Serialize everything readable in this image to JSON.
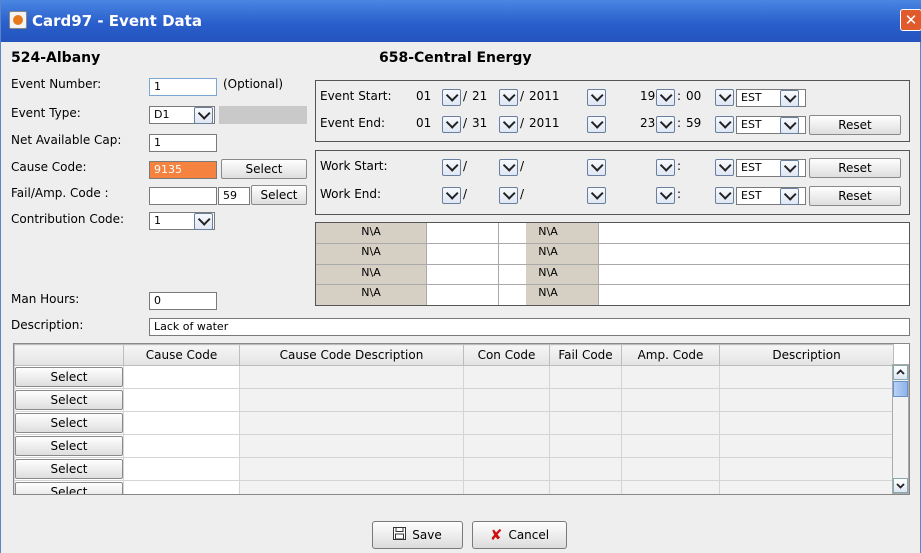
{
  "window": {
    "title": "Card97 - Event Data"
  },
  "unit": {
    "left_name": "524-Albany",
    "right_name": "658-Central Energy"
  },
  "fields": {
    "event_number_label": "Event Number:",
    "event_number": "1",
    "optional_note": "(Optional)",
    "event_type_label": "Event Type:",
    "event_type": "D1",
    "net_available_cap_label": "Net Available Cap:",
    "net_available_cap": "1",
    "cause_code_label": "Cause Code:",
    "cause_code": "9135",
    "cause_select": "Select",
    "fail_amp_label": "Fail/Amp. Code :",
    "fail_code": "",
    "amp_code": "59",
    "fail_select": "Select",
    "contribution_label": "Contribution Code:",
    "contribution": "1",
    "man_hours_label": "Man Hours:",
    "man_hours": "0",
    "description_label": "Description:",
    "description": "Lack of water"
  },
  "event_times": {
    "start_label": "Event Start:",
    "end_label": "Event End:",
    "start": {
      "month": "01",
      "day": "21",
      "year": "2011",
      "hour": "19",
      "minute": "00",
      "tz": "EST"
    },
    "end": {
      "month": "01",
      "day": "31",
      "year": "2011",
      "hour": "23",
      "minute": "59",
      "tz": "EST"
    },
    "reset": "Reset",
    "slash": "/",
    "colon": ":"
  },
  "work_times": {
    "start_label": "Work Start:",
    "end_label": "Work End:",
    "tz": "EST",
    "reset": "Reset",
    "slash": "/",
    "colon": ":"
  },
  "na_grid": {
    "cells": [
      "N\\A",
      "N\\A",
      "N\\A",
      "N\\A",
      "N\\A",
      "N\\A",
      "N\\A",
      "N\\A"
    ]
  },
  "table": {
    "columns": [
      "",
      "Cause Code",
      "Cause Code Description",
      "Con Code",
      "Fail Code",
      "Amp. Code",
      "Description"
    ],
    "row_button": "Select"
  },
  "actions": {
    "save": "Save",
    "cancel": "Cancel"
  },
  "colors": {
    "cause_code_bg": "#f5823f",
    "titlebar": "#2a5fcc",
    "na_cell": "#d6d0c4"
  }
}
